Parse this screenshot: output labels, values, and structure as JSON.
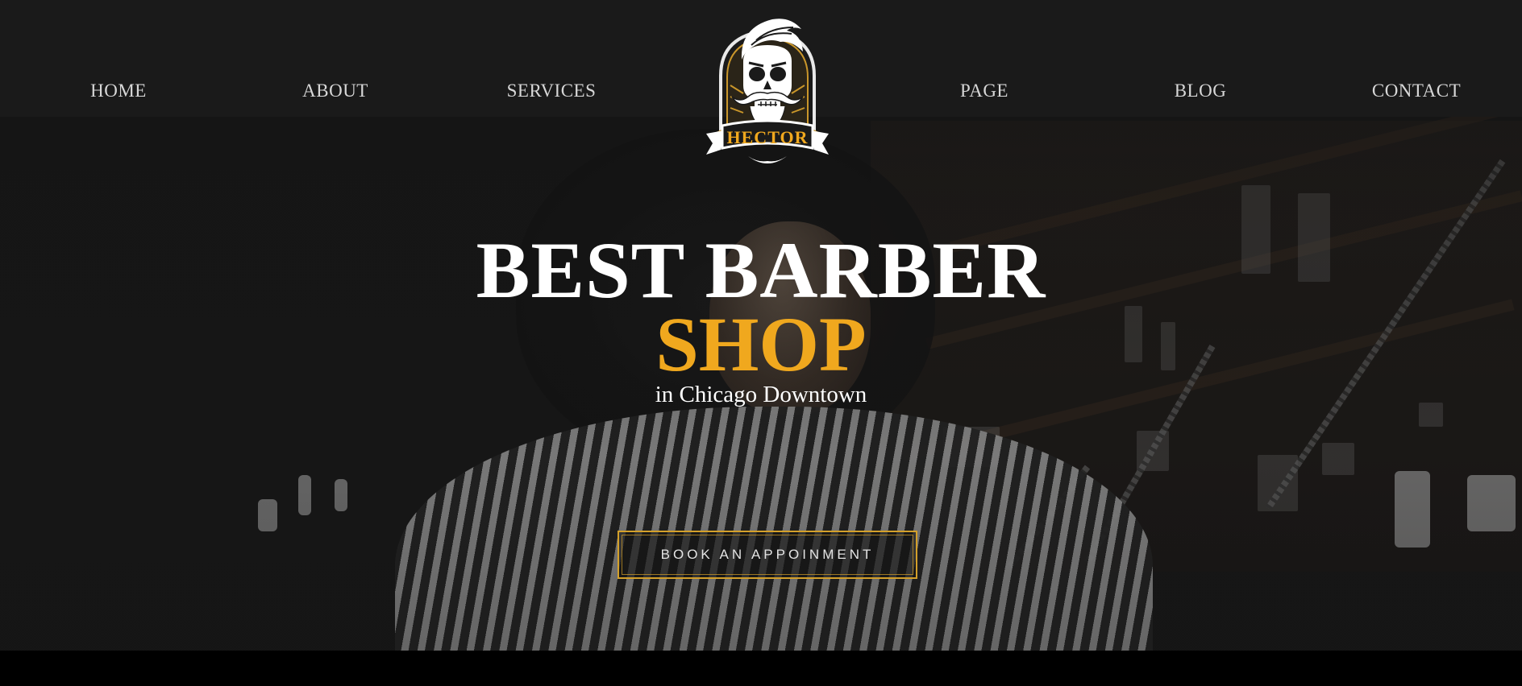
{
  "nav": {
    "left": [
      {
        "label": "HOME"
      },
      {
        "label": "ABOUT"
      },
      {
        "label": "SERVICES"
      }
    ],
    "right": [
      {
        "label": "PAGE"
      },
      {
        "label": "BLOG"
      },
      {
        "label": "CONTACT"
      }
    ]
  },
  "logo": {
    "icon": "skull-with-mustache-and-pompadour",
    "text": "HECTOR"
  },
  "hero": {
    "title_line1": "BEST BARBER",
    "title_line2": "SHOP",
    "subtitle": "in Chicago Downtown",
    "cta_label": "BOOK AN APPOINMENT"
  },
  "colors": {
    "accent": "#f0a81e",
    "background": "#1a1a1a",
    "nav_text": "#d7d7d7",
    "cta_border": "#d4a02a"
  }
}
